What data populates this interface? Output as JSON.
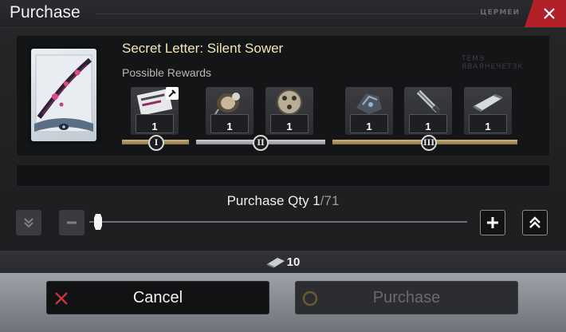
{
  "dialog": {
    "title": "Purchase",
    "title_mark": "ЦЕРМЕИ",
    "watermark": "ТЕМЭ ЯВАЯНЕЧЕТЗК"
  },
  "item": {
    "name": "Secret Letter: Silent Sower",
    "rewards_label": "Possible Rewards"
  },
  "reward_groups": [
    {
      "tier": "I",
      "style": "gold",
      "rewards": [
        {
          "icon": "letter-icon",
          "count": "1",
          "tagged": true
        }
      ]
    },
    {
      "tier": "II",
      "style": "silver",
      "rewards": [
        {
          "icon": "mask-icon",
          "count": "1"
        },
        {
          "icon": "ball-icon",
          "count": "1"
        }
      ]
    },
    {
      "tier": "III",
      "style": "gold",
      "rewards": [
        {
          "icon": "gauntlet-icon",
          "count": "1"
        },
        {
          "icon": "blade-icon",
          "count": "1"
        },
        {
          "icon": "scroll-icon",
          "count": "1"
        }
      ]
    }
  ],
  "quantity": {
    "label": "Purchase Qty ",
    "current": "1",
    "separator": "/",
    "max": "71",
    "fraction": 0.0
  },
  "cost": {
    "icon": "currency-icon",
    "value": "10"
  },
  "buttons": {
    "cancel": "Cancel",
    "purchase": "Purchase"
  },
  "colors": {
    "accent_gold": "#c9b07a",
    "close_red": "#b4202a",
    "item_name": "#f4e6b5"
  }
}
